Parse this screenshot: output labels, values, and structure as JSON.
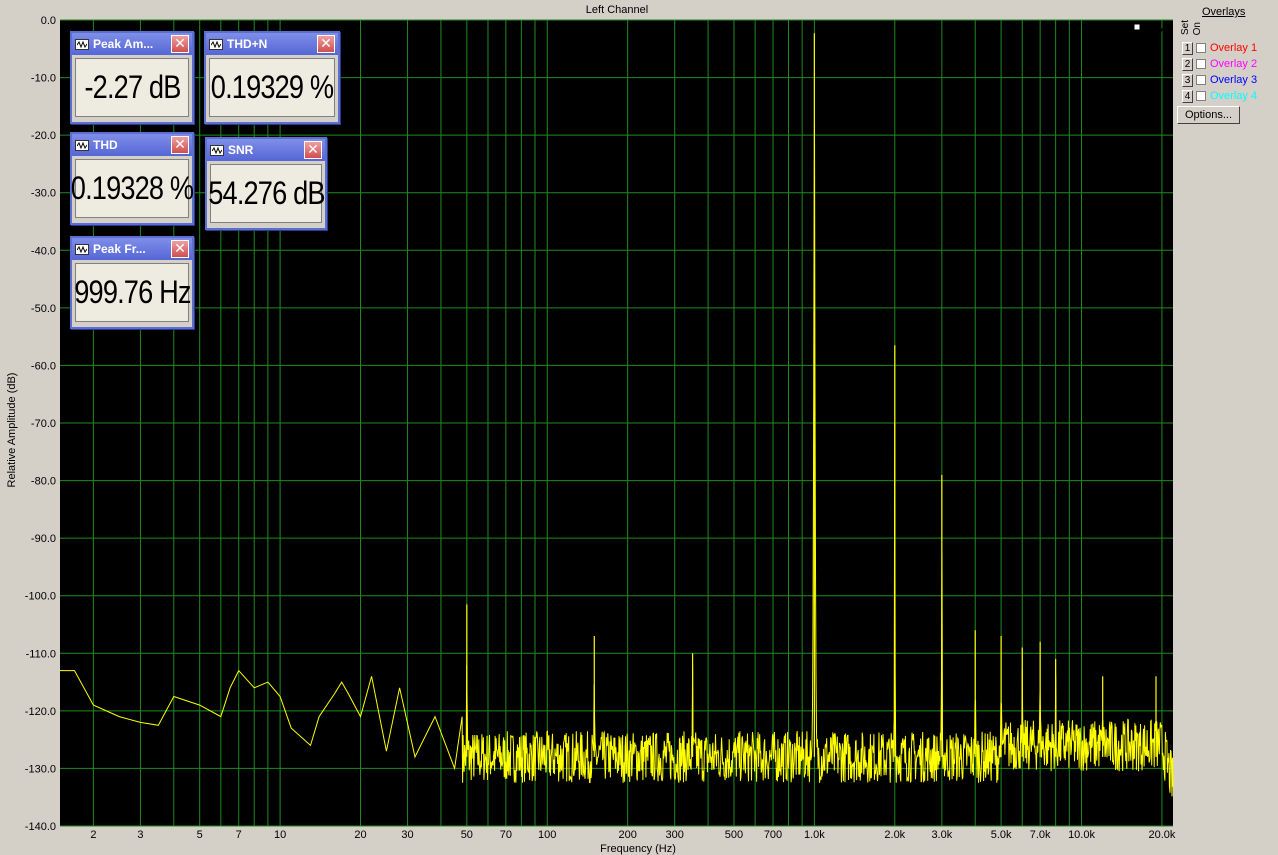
{
  "chart_data": {
    "type": "line",
    "title": "Left Channel",
    "xlabel": "Frequency (Hz)",
    "ylabel": "Relative Amplitude (dB)",
    "xscale": "log",
    "xlim": [
      1.5,
      22000
    ],
    "ylim": [
      -140,
      0
    ],
    "x_tick_values": [
      2,
      3,
      5,
      7,
      10,
      20,
      30,
      50,
      70,
      100,
      200,
      300,
      500,
      700,
      1000,
      2000,
      3000,
      5000,
      7000,
      10000,
      20000
    ],
    "x_tick_labels": [
      "2",
      "3",
      "5",
      "7",
      "10",
      "20",
      "30",
      "50",
      "70",
      "100",
      "200",
      "300",
      "500",
      "700",
      "1.0k",
      "2.0k",
      "3.0k",
      "5.0k",
      "7.0k",
      "10.0k",
      "20.0k"
    ],
    "y_tick_values": [
      0,
      -10,
      -20,
      -30,
      -40,
      -50,
      -60,
      -70,
      -80,
      -90,
      -100,
      -110,
      -120,
      -130,
      -140
    ],
    "y_tick_labels": [
      "0.0",
      "-10.0",
      "-20.0",
      "-30.0",
      "-40.0",
      "-50.0",
      "-60.0",
      "-70.0",
      "-80.0",
      "-90.0",
      "-100.0",
      "-110.0",
      "-120.0",
      "-130.0",
      "-140.0"
    ],
    "grid": true,
    "background": "#000000",
    "grid_color": "#1e8c1e",
    "series_color": "#ffff00",
    "noise_floor_trace": [
      [
        1.5,
        -113
      ],
      [
        1.7,
        -113
      ],
      [
        2.0,
        -119
      ],
      [
        2.5,
        -121
      ],
      [
        3.0,
        -122
      ],
      [
        3.5,
        -122.5
      ],
      [
        4.0,
        -117.5
      ],
      [
        5.0,
        -119
      ],
      [
        6.0,
        -121
      ],
      [
        6.5,
        -116
      ],
      [
        7.0,
        -113
      ],
      [
        8.0,
        -116
      ],
      [
        9.0,
        -115
      ],
      [
        10.0,
        -117.5
      ],
      [
        11,
        -123
      ],
      [
        13,
        -126
      ],
      [
        14,
        -121
      ],
      [
        16,
        -117
      ],
      [
        17,
        -115
      ],
      [
        18,
        -117
      ],
      [
        20,
        -121
      ],
      [
        22,
        -114
      ],
      [
        25,
        -127
      ],
      [
        28,
        -116
      ],
      [
        32,
        -128
      ],
      [
        38,
        -121
      ],
      [
        45,
        -130
      ],
      [
        48,
        -121
      ]
    ],
    "peaks": [
      {
        "freq": 50,
        "db": -101.5
      },
      {
        "freq": 150,
        "db": -107
      },
      {
        "freq": 350,
        "db": -110
      },
      {
        "freq": 999.76,
        "db": -2.3
      },
      {
        "freq": 2000,
        "db": -56.5
      },
      {
        "freq": 3000,
        "db": -79
      },
      {
        "freq": 4000,
        "db": -106
      },
      {
        "freq": 5000,
        "db": -107
      },
      {
        "freq": 6000,
        "db": -109
      },
      {
        "freq": 7000,
        "db": -108
      },
      {
        "freq": 8000,
        "db": -111
      },
      {
        "freq": 12000,
        "db": -114
      },
      {
        "freq": 19000,
        "db": -114
      }
    ],
    "floor_level_db": -128
  },
  "meters": [
    {
      "title": "Peak Am...",
      "value": "-2.27 dB"
    },
    {
      "title": "THD+N",
      "value": "0.19329 %"
    },
    {
      "title": "THD",
      "value": "0.19328 %"
    },
    {
      "title": "SNR",
      "value": "54.276 dB"
    },
    {
      "title": "Peak Fr...",
      "value": "999.76 Hz"
    }
  ],
  "overlays": {
    "title": "Overlays",
    "set_label": "Set",
    "on_label": "On",
    "items": [
      {
        "num": "1",
        "label": "Overlay 1",
        "color": "#ff0000"
      },
      {
        "num": "2",
        "label": "Overlay 2",
        "color": "#ff00ff"
      },
      {
        "num": "3",
        "label": "Overlay 3",
        "color": "#0000ff"
      },
      {
        "num": "4",
        "label": "Overlay 4",
        "color": "#00ffff"
      }
    ],
    "options_label": "Options..."
  }
}
